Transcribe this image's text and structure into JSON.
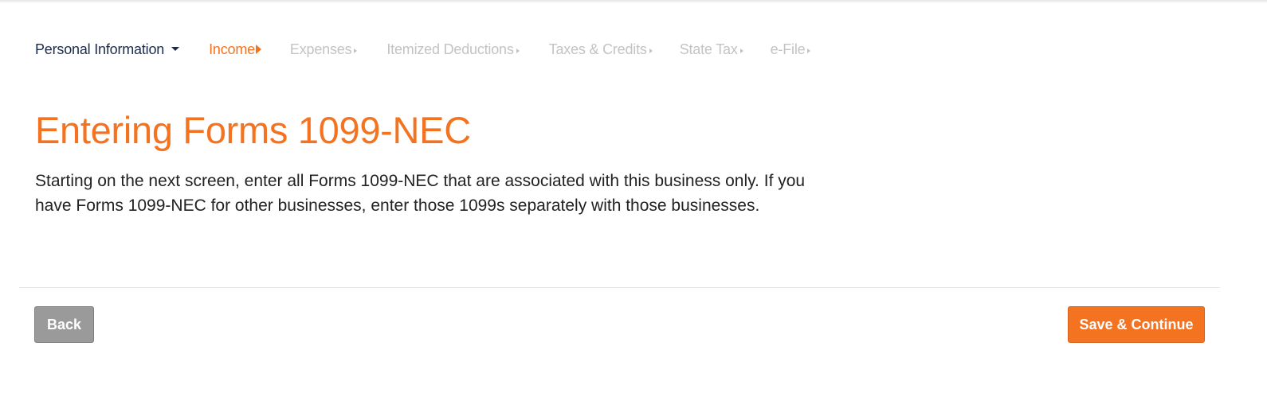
{
  "nav": {
    "items": [
      {
        "label": "Personal Information",
        "state": "completed"
      },
      {
        "label": "Income",
        "state": "active"
      },
      {
        "label": "Expenses",
        "state": "upcoming"
      },
      {
        "label": "Itemized Deductions",
        "state": "upcoming"
      },
      {
        "label": "Taxes & Credits",
        "state": "upcoming"
      },
      {
        "label": "State Tax",
        "state": "upcoming"
      },
      {
        "label": "e-File",
        "state": "upcoming"
      }
    ]
  },
  "page": {
    "title": "Entering Forms 1099-NEC",
    "description": "Starting on the next screen, enter all Forms 1099-NEC that are associated with this business only. If you have Forms 1099-NEC for other businesses, enter those 1099s separately with those businesses."
  },
  "actions": {
    "back_label": "Back",
    "continue_label": "Save & Continue"
  },
  "colors": {
    "accent": "#f47321",
    "nav_active_text": "#1c2b4a",
    "nav_muted_text": "#c3c3c3",
    "back_button": "#9a9a9a"
  }
}
